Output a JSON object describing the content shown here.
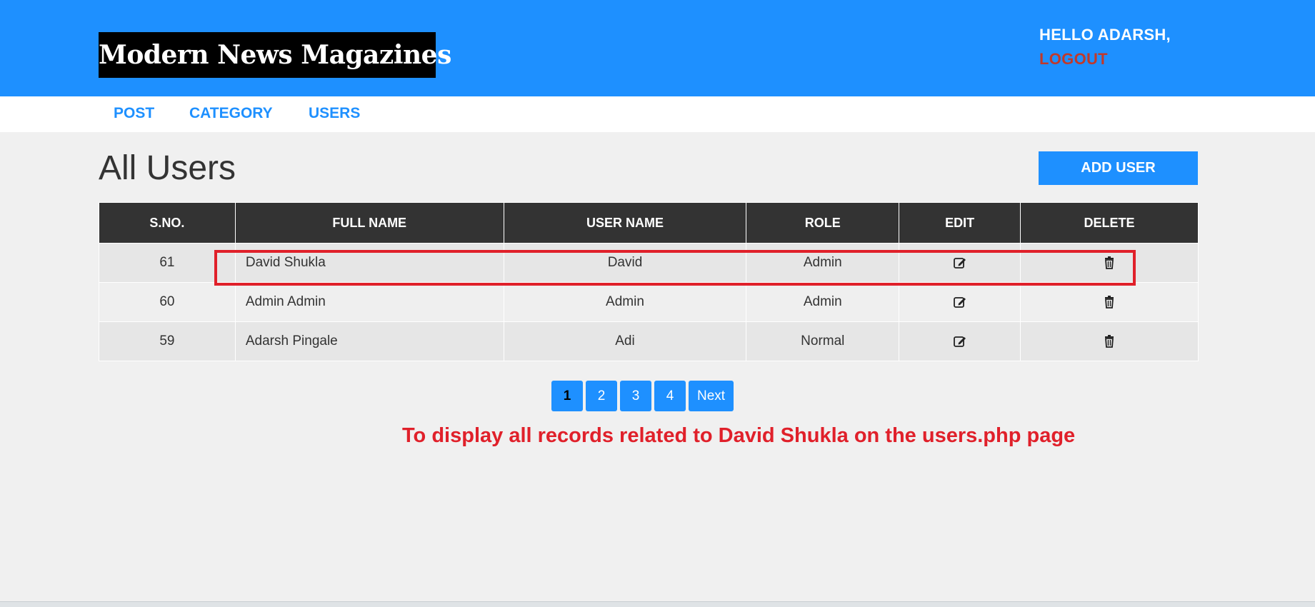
{
  "header": {
    "logo": "Modern News Magazines",
    "greeting": "HELLO ADARSH,",
    "logout": "LOGOUT"
  },
  "menu": {
    "items": [
      {
        "label": "POST"
      },
      {
        "label": "CATEGORY"
      },
      {
        "label": "USERS"
      }
    ]
  },
  "main": {
    "title": "All Users",
    "add_user_label": "ADD USER"
  },
  "table": {
    "headers": [
      "S.NO.",
      "FULL NAME",
      "USER NAME",
      "ROLE",
      "EDIT",
      "DELETE"
    ],
    "rows": [
      {
        "sno": "61",
        "full_name": "David Shukla",
        "user_name": "David",
        "role": "Admin",
        "edit_icon": "edit-icon",
        "delete_icon": "trash-icon"
      },
      {
        "sno": "60",
        "full_name": "Admin Admin",
        "user_name": "Admin",
        "role": "Admin",
        "edit_icon": "edit-icon",
        "delete_icon": "trash-icon"
      },
      {
        "sno": "59",
        "full_name": "Adarsh Pingale",
        "user_name": "Adi",
        "role": "Normal",
        "edit_icon": "edit-icon",
        "delete_icon": "trash-icon"
      }
    ]
  },
  "pagination": {
    "pages": [
      "1",
      "2",
      "3",
      "4"
    ],
    "active_page": "1",
    "next_label": "Next"
  },
  "annotation": {
    "text": "To display all records related to David Shukla on the users.php page",
    "color": "#e0202a"
  },
  "colors": {
    "brand": "#1e90ff",
    "logout": "#c0392b",
    "table_header": "#333333"
  }
}
